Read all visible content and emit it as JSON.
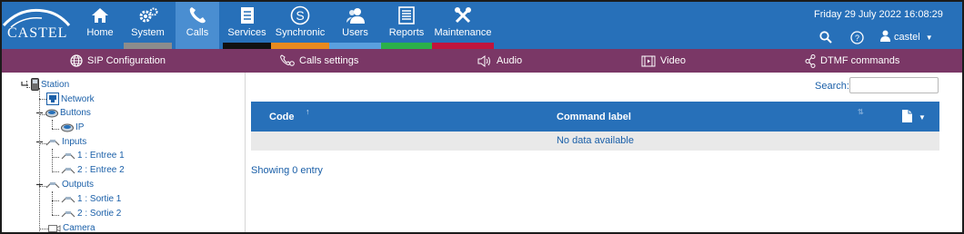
{
  "brand": {
    "logo_text": "CASTEL"
  },
  "nav": {
    "items": [
      {
        "id": "home",
        "label": "Home",
        "icon": "home-icon",
        "stripe": ""
      },
      {
        "id": "system",
        "label": "System",
        "icon": "gears-icon",
        "stripe": "#8c8c8c"
      },
      {
        "id": "calls",
        "label": "Calls",
        "icon": "phone-icon",
        "stripe": "",
        "active": true
      },
      {
        "id": "services",
        "label": "Services",
        "icon": "document-icon",
        "stripe": "#111111"
      },
      {
        "id": "synchronic",
        "label": "Synchronic",
        "icon": "s-circle-icon",
        "stripe": "#e88a1e"
      },
      {
        "id": "users",
        "label": "Users",
        "icon": "users-icon",
        "stripe": "#5aa0df"
      },
      {
        "id": "reports",
        "label": "Reports",
        "icon": "list-icon",
        "stripe": "#2bb04a"
      },
      {
        "id": "maintenance",
        "label": "Maintenance",
        "icon": "tools-icon",
        "stripe": "#c0143c"
      }
    ]
  },
  "header": {
    "datetime": "Friday 29 July 2022 16:08:29",
    "username": "castel"
  },
  "subnav": {
    "items": [
      {
        "id": "sip",
        "label": "SIP Configuration",
        "icon": "globe-icon"
      },
      {
        "id": "calls_settings",
        "label": "Calls settings",
        "icon": "call-settings-icon"
      },
      {
        "id": "audio",
        "label": "Audio",
        "icon": "speaker-icon"
      },
      {
        "id": "video",
        "label": "Video",
        "icon": "film-icon"
      },
      {
        "id": "dtmf",
        "label": "DTMF commands",
        "icon": "share-icon"
      }
    ]
  },
  "tree": {
    "station": "Station",
    "network": "Network",
    "buttons": "Buttons",
    "ip": "IP",
    "inputs": "Inputs",
    "input1": "1 : Entree 1",
    "input2": "2 : Entree 2",
    "outputs": "Outputs",
    "output1": "1 : Sortie 1",
    "output2": "2 : Sortie 2",
    "camera": "Camera"
  },
  "main": {
    "search_label": "Search:",
    "search_value": "",
    "table": {
      "columns": [
        "Code",
        "Command label"
      ],
      "empty_text": "No data available"
    },
    "info": "Showing 0 entry"
  }
}
